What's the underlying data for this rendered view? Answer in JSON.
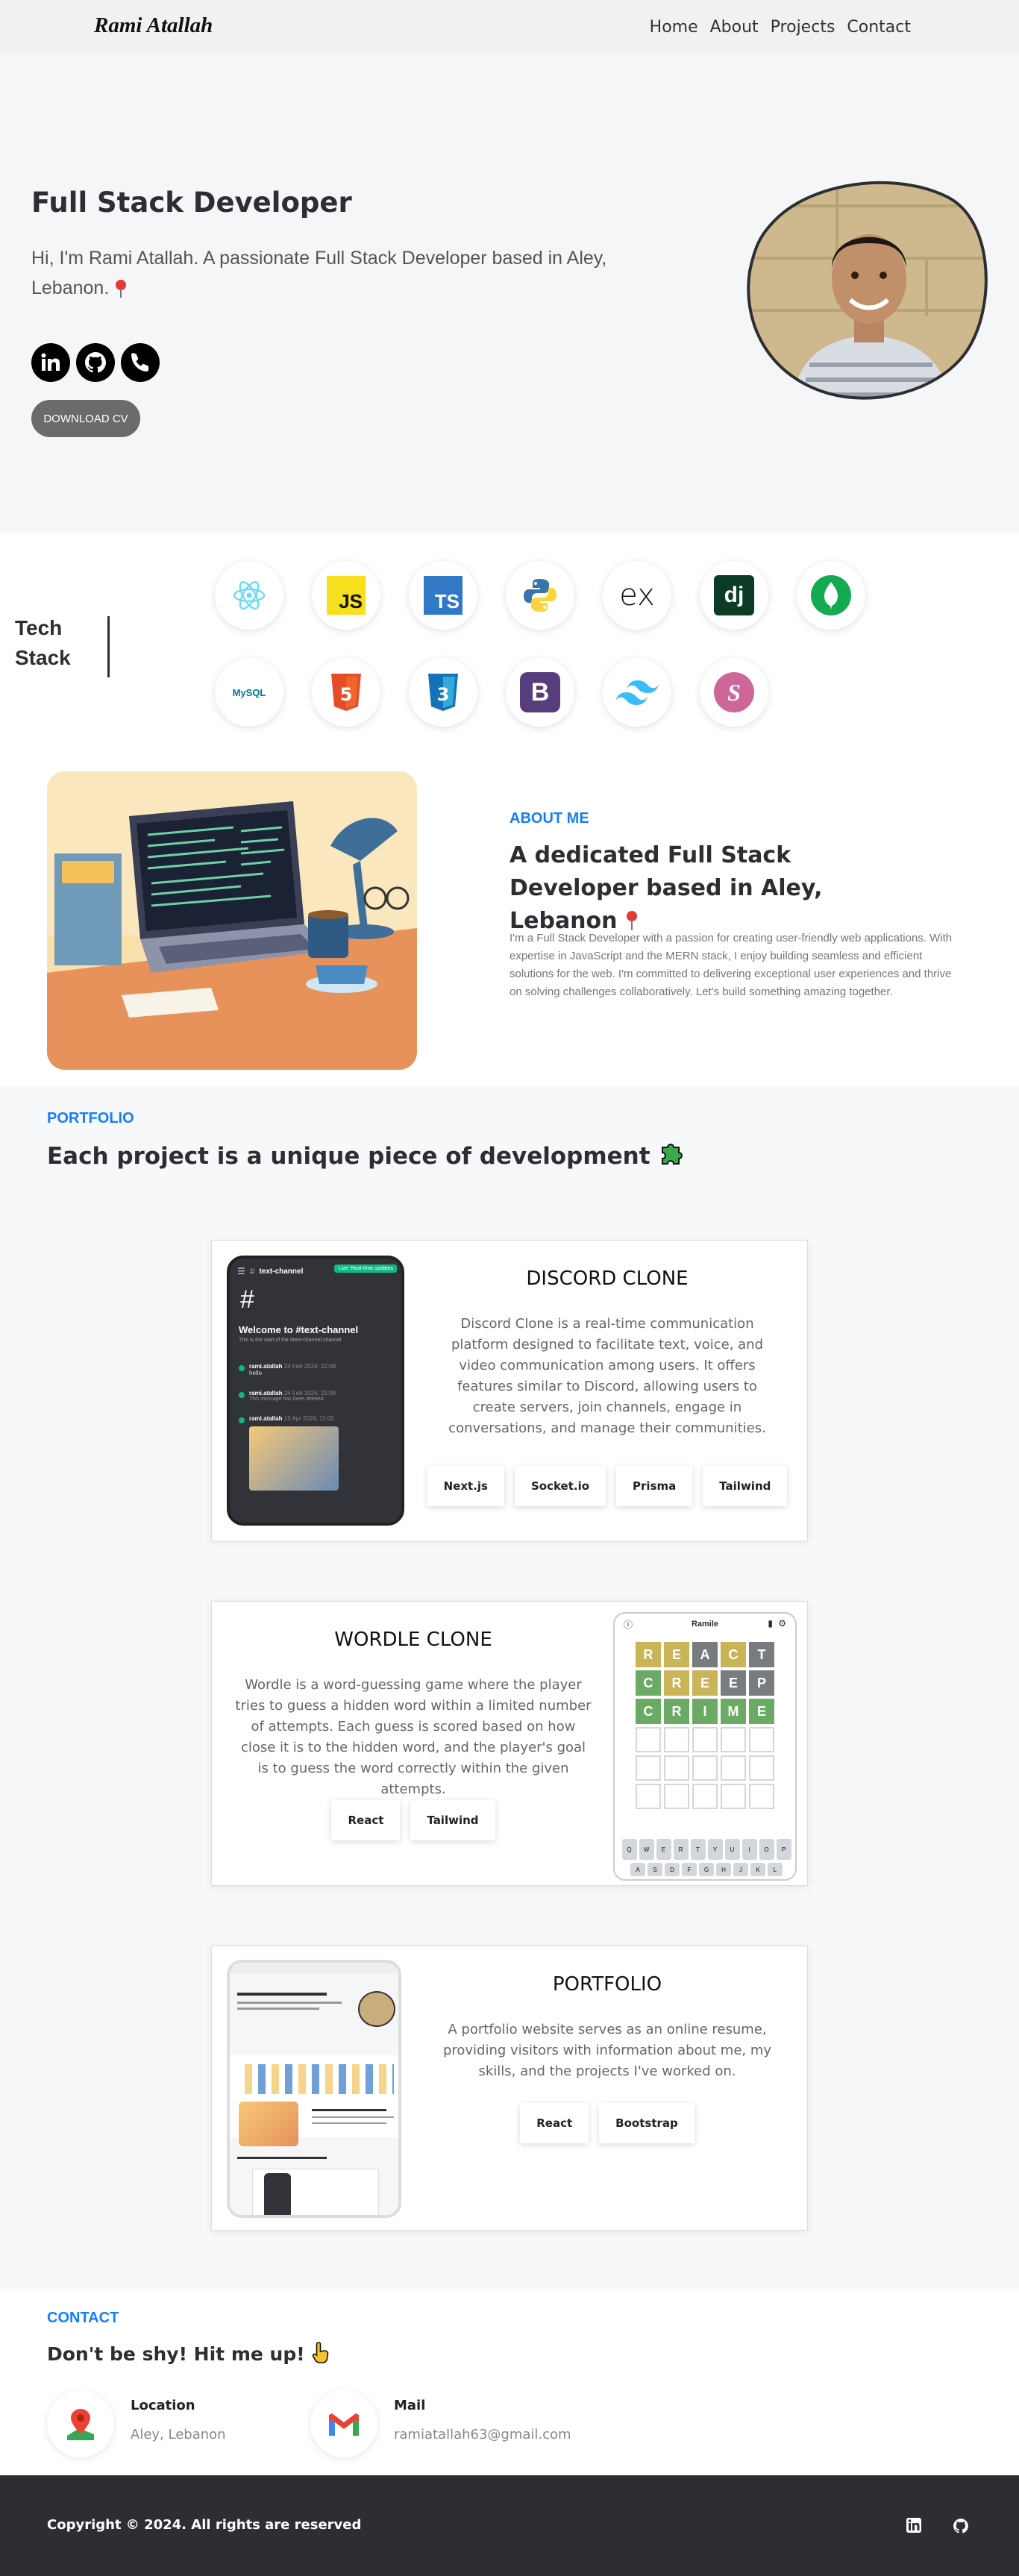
{
  "nav": {
    "brand": "Rami Atallah",
    "links": [
      "Home",
      "About",
      "Projects",
      "Contact"
    ]
  },
  "hero": {
    "title": "Full Stack Developer",
    "subtitle": "Hi, I'm Rami Atallah. A passionate Full Stack Developer based in Aley, Lebanon.",
    "social_icons": [
      "linkedin-icon",
      "github-icon",
      "phone-icon"
    ],
    "cv_button": "DOWNLOAD CV"
  },
  "tech": {
    "label_line1": "Tech",
    "label_line2": "Stack",
    "items": [
      {
        "icon": "react-icon",
        "text": ""
      },
      {
        "icon": "javascript-icon",
        "text": "JS"
      },
      {
        "icon": "typescript-icon",
        "text": "TS"
      },
      {
        "icon": "python-icon",
        "text": ""
      },
      {
        "icon": "express-icon",
        "text": "ex"
      },
      {
        "icon": "django-icon",
        "text": "dj"
      },
      {
        "icon": "mongodb-icon",
        "text": ""
      },
      {
        "icon": "mysql-icon",
        "text": "MySQL"
      },
      {
        "icon": "html5-icon",
        "text": "5"
      },
      {
        "icon": "css3-icon",
        "text": "3"
      },
      {
        "icon": "bootstrap-icon",
        "text": "B"
      },
      {
        "icon": "tailwind-icon",
        "text": ""
      },
      {
        "icon": "sass-icon",
        "text": "S"
      }
    ]
  },
  "about": {
    "eyebrow": "ABOUT ME",
    "title": "A dedicated Full Stack Developer based in Aley, Lebanon",
    "text": "I'm a Full Stack Developer with a passion for creating user-friendly web applications. With expertise in JavaScript and the MERN stack, I enjoy building seamless and efficient solutions for the web. I'm committed to delivering exceptional user experiences and thrive on solving challenges collaboratively. Let's build something amazing together."
  },
  "portfolio": {
    "eyebrow": "PORTFOLIO",
    "title": "Each project is a unique piece of development",
    "projects": [
      {
        "title": "DISCORD CLONE",
        "description": "Discord Clone is a real-time communication platform designed to facilitate text, voice, and video communication among users. It offers features similar to Discord, allowing users to create servers, join channels, engage in conversations, and manage their communities.",
        "tags": [
          "Next.js",
          "Socket.io",
          "Prisma",
          "Tailwind"
        ],
        "preview": {
          "channel": "text-channel",
          "badge": "Live: Real-time updates",
          "welcome": "Welcome to #text-channel",
          "welcome_sub": "This is the start of the #text-channel channel.",
          "messages": [
            {
              "user": "rami.atallah",
              "time": "24 Feb 2024, 22:08",
              "text": "hello"
            },
            {
              "user": "rami.atallah",
              "time": "24 Feb 2024, 22:08",
              "text": "This message has been deleted."
            },
            {
              "user": "rami.atallah",
              "time": "13 Apr 2024, 11:02",
              "text": ""
            }
          ]
        }
      },
      {
        "title": "WORDLE CLONE",
        "description": "Wordle is a word-guessing game where the player tries to guess a hidden word within a limited number of attempts. Each guess is scored based on how close it is to the hidden word, and the player's goal is to guess the word correctly within the given attempts.",
        "tags": [
          "React",
          "Tailwind"
        ],
        "preview": {
          "app_title": "Ramile",
          "rows": [
            {
              "letters": [
                "R",
                "E",
                "A",
                "C",
                "T"
              ],
              "colors": [
                "#c9b458",
                "#c9b458",
                "#787c7e",
                "#c9b458",
                "#787c7e"
              ]
            },
            {
              "letters": [
                "C",
                "R",
                "E",
                "E",
                "P"
              ],
              "colors": [
                "#6aaa64",
                "#c9b458",
                "#c9b458",
                "#787c7e",
                "#787c7e"
              ]
            },
            {
              "letters": [
                "C",
                "R",
                "I",
                "M",
                "E"
              ],
              "colors": [
                "#6aaa64",
                "#6aaa64",
                "#6aaa64",
                "#6aaa64",
                "#6aaa64"
              ]
            }
          ],
          "keyboard_row1": [
            "Q",
            "W",
            "E",
            "R",
            "T",
            "Y",
            "U",
            "I",
            "O",
            "P"
          ],
          "keyboard_row2": [
            "A",
            "S",
            "D",
            "F",
            "G",
            "H",
            "J",
            "K",
            "L"
          ]
        }
      },
      {
        "title": "PORTFOLIO",
        "description": "A portfolio website serves as an online resume, providing visitors with information about me, my skills, and the projects I've worked on.",
        "tags": [
          "React",
          "Bootstrap"
        ]
      }
    ]
  },
  "contact": {
    "eyebrow": "CONTACT",
    "title": "Don't be shy! Hit me up!",
    "location_label": "Location",
    "location_value": "Aley, Lebanon",
    "mail_label": "Mail",
    "mail_value": "ramiatallah63@gmail.com"
  },
  "footer": {
    "copyright": "Copyright © 2024. All rights are reserved"
  },
  "colors": {
    "accent": "#147efb",
    "dark": "#2d2e32"
  }
}
